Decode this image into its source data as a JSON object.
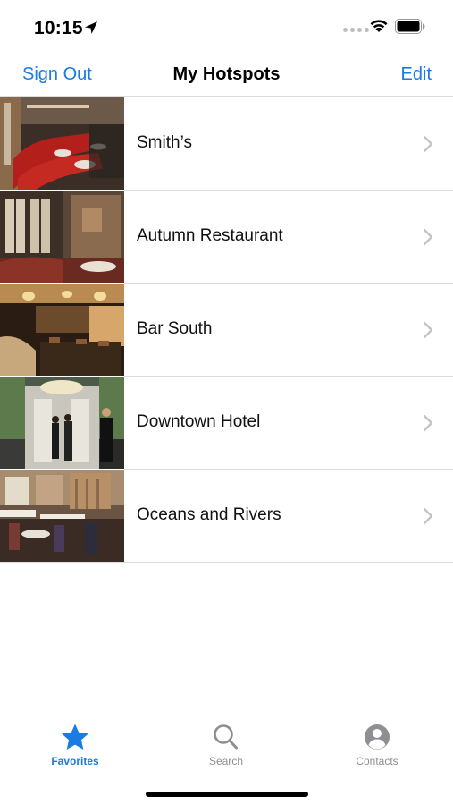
{
  "status_bar": {
    "time": "10:15",
    "icons": [
      "location-arrow-icon",
      "cellular-dots-icon",
      "wifi-icon",
      "battery-icon"
    ]
  },
  "nav_bar": {
    "left_label": "Sign Out",
    "title": "My Hotspots",
    "right_label": "Edit",
    "accent_color": "#1a7be0"
  },
  "list": {
    "items": [
      {
        "label": "Smith’s",
        "thumbnail": "restaurant-red-booths-photo"
      },
      {
        "label": "Autumn Restaurant",
        "thumbnail": "restaurant-dining-room-photo"
      },
      {
        "label": "Bar South",
        "thumbnail": "bar-interior-photo"
      },
      {
        "label": "Downtown Hotel",
        "thumbnail": "hotel-lobby-photo"
      },
      {
        "label": "Oceans and Rivers",
        "thumbnail": "restaurant-tables-photo"
      }
    ]
  },
  "tab_bar": {
    "tabs": [
      {
        "label": "Favorites",
        "icon": "star-icon",
        "active": true
      },
      {
        "label": "Search",
        "icon": "magnifier-icon",
        "active": false
      },
      {
        "label": "Contacts",
        "icon": "person-circle-icon",
        "active": false
      }
    ],
    "active_color": "#1a7be0",
    "inactive_color": "#8e8e93"
  }
}
